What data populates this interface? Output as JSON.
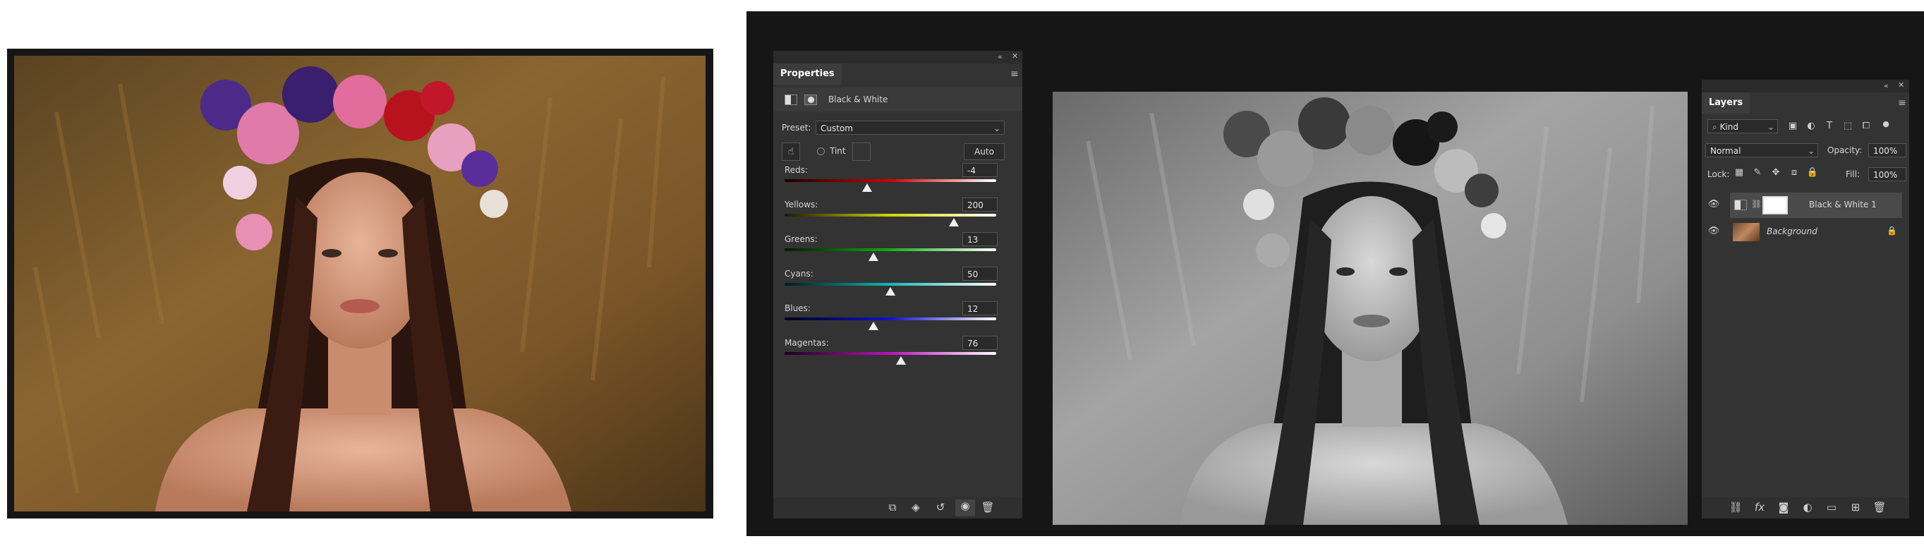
{
  "properties_panel": {
    "tab_label": "Properties",
    "adjustment_name": "Black & White",
    "preset_label": "Preset:",
    "preset_value": "Custom",
    "tint_label": "Tint",
    "auto_label": "Auto",
    "sliders": [
      {
        "label": "Reds:",
        "value": "-4",
        "level": 0.39,
        "gradient": [
          "#1a0000",
          "#d00000",
          "#ffffff"
        ]
      },
      {
        "label": "Yellows:",
        "value": "200",
        "level": 0.8,
        "gradient": [
          "#1a1a00",
          "#d4d400",
          "#ffffff"
        ]
      },
      {
        "label": "Greens:",
        "value": "13",
        "level": 0.42,
        "gradient": [
          "#001a00",
          "#10b010",
          "#ffffff"
        ]
      },
      {
        "label": "Cyans:",
        "value": "50",
        "level": 0.5,
        "gradient": [
          "#001a1a",
          "#10b8b8",
          "#ffffff"
        ]
      },
      {
        "label": "Blues:",
        "value": "12",
        "level": 0.42,
        "gradient": [
          "#00001a",
          "#1010d0",
          "#ffffff"
        ]
      },
      {
        "label": "Magentas:",
        "value": "76",
        "level": 0.55,
        "gradient": [
          "#1a001a",
          "#c010c0",
          "#ffffff"
        ]
      }
    ]
  },
  "layers_panel": {
    "tab_label": "Layers",
    "filter_label": "Kind",
    "blend_mode": "Normal",
    "opacity_label": "Opacity:",
    "opacity_value": "100%",
    "lock_label": "Lock:",
    "fill_label": "Fill:",
    "fill_value": "100%",
    "layers": [
      {
        "name": "Black & White 1",
        "selected": true
      },
      {
        "name": "Background",
        "selected": false
      }
    ]
  },
  "colors": {
    "ps_background": "#161616",
    "panel": "#333333",
    "selected_layer": "#4a4a4a"
  }
}
